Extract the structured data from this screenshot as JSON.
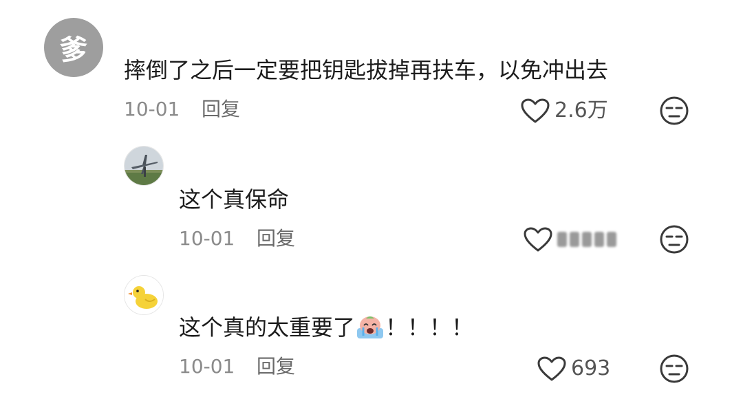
{
  "comments": [
    {
      "avatar_text": "爹",
      "text": "摔倒了之后一定要把钥匙拔掉再扶车，以免冲出去",
      "date": "10-01",
      "reply_label": "回复",
      "likes": "2.6万"
    },
    {
      "text": "这个真保命",
      "date": "10-01",
      "reply_label": "回复",
      "likes": ""
    },
    {
      "text_before": "这个真的太重要了",
      "text_after": "！！！！",
      "date": "10-01",
      "reply_label": "回复",
      "likes": "693"
    }
  ],
  "icons": {
    "like": "heart-outline-icon",
    "dislike": "unamused-face-icon",
    "emoji": "crying-face-emoji"
  }
}
